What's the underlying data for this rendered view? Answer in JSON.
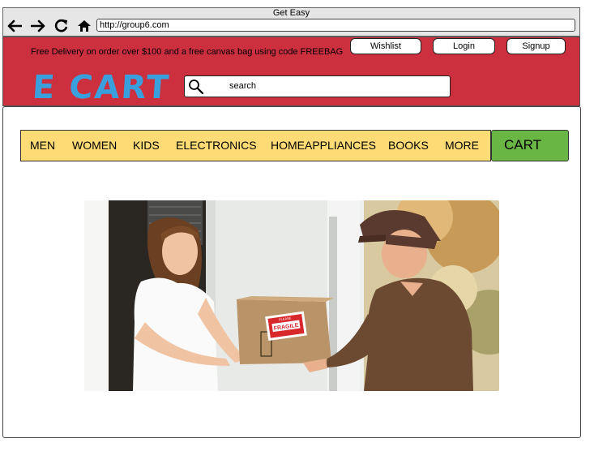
{
  "browser": {
    "title": "Get Easy",
    "url": "http://group6.com",
    "nav_icons": [
      "back-arrow-icon",
      "forward-arrow-icon",
      "reload-icon",
      "home-icon"
    ]
  },
  "header": {
    "promo_text": "Free Delivery on order over $100 and a free canvas bag using code FREEBAG",
    "buttons": {
      "wishlist": "Wishlist",
      "login": "Login",
      "signup": "Signup"
    },
    "logo_text": "E CART",
    "search_placeholder": "search",
    "colors": {
      "header_bg": "#cc2f3e",
      "logo": "#3aa0dd"
    }
  },
  "menu": {
    "items": [
      "MEN",
      "WOMEN",
      "KIDS",
      "ELECTRONICS",
      "HOMEAPPLIANCES",
      "BOOKS",
      "MORE"
    ],
    "cart_label": "CART",
    "colors": {
      "menu_bg": "#ffdb76",
      "cart_bg": "#6ab644"
    }
  },
  "hero": {
    "box_label_1": "PLEASE",
    "box_label_2": "FRAGILE"
  }
}
